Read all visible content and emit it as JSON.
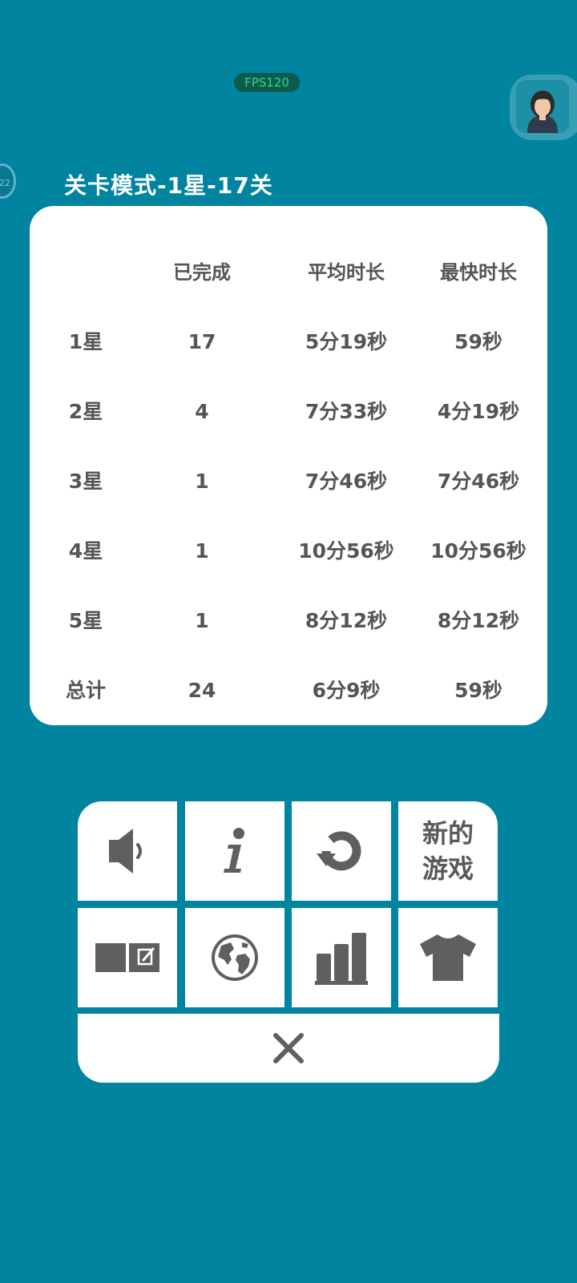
{
  "status": {
    "fps_label": "FPS120"
  },
  "side_badge": {
    "text": "22"
  },
  "title": "关卡模式-1星-17关",
  "stats": {
    "headers": [
      "",
      "已完成",
      "平均时长",
      "最快时长"
    ],
    "rows": [
      {
        "label": "1星",
        "completed": "17",
        "avg": "5分19秒",
        "fastest": "59秒"
      },
      {
        "label": "2星",
        "completed": "4",
        "avg": "7分33秒",
        "fastest": "4分19秒"
      },
      {
        "label": "3星",
        "completed": "1",
        "avg": "7分46秒",
        "fastest": "7分46秒"
      },
      {
        "label": "4星",
        "completed": "1",
        "avg": "10分56秒",
        "fastest": "10分56秒"
      },
      {
        "label": "5星",
        "completed": "1",
        "avg": "8分12秒",
        "fastest": "8分12秒"
      },
      {
        "label": "总计",
        "completed": "24",
        "avg": "6分9秒",
        "fastest": "59秒"
      }
    ]
  },
  "menu": {
    "new_game_line1": "新的",
    "new_game_line2": "游戏",
    "icons": [
      "sound-icon",
      "info-icon",
      "restart-icon",
      "notes-toggle-icon",
      "language-globe-icon",
      "statistics-icon",
      "theme-shirt-icon",
      "close-icon"
    ]
  },
  "colors": {
    "background": "#00849f",
    "card": "#ffffff",
    "text": "#555555",
    "icon": "#5f5f5f"
  }
}
